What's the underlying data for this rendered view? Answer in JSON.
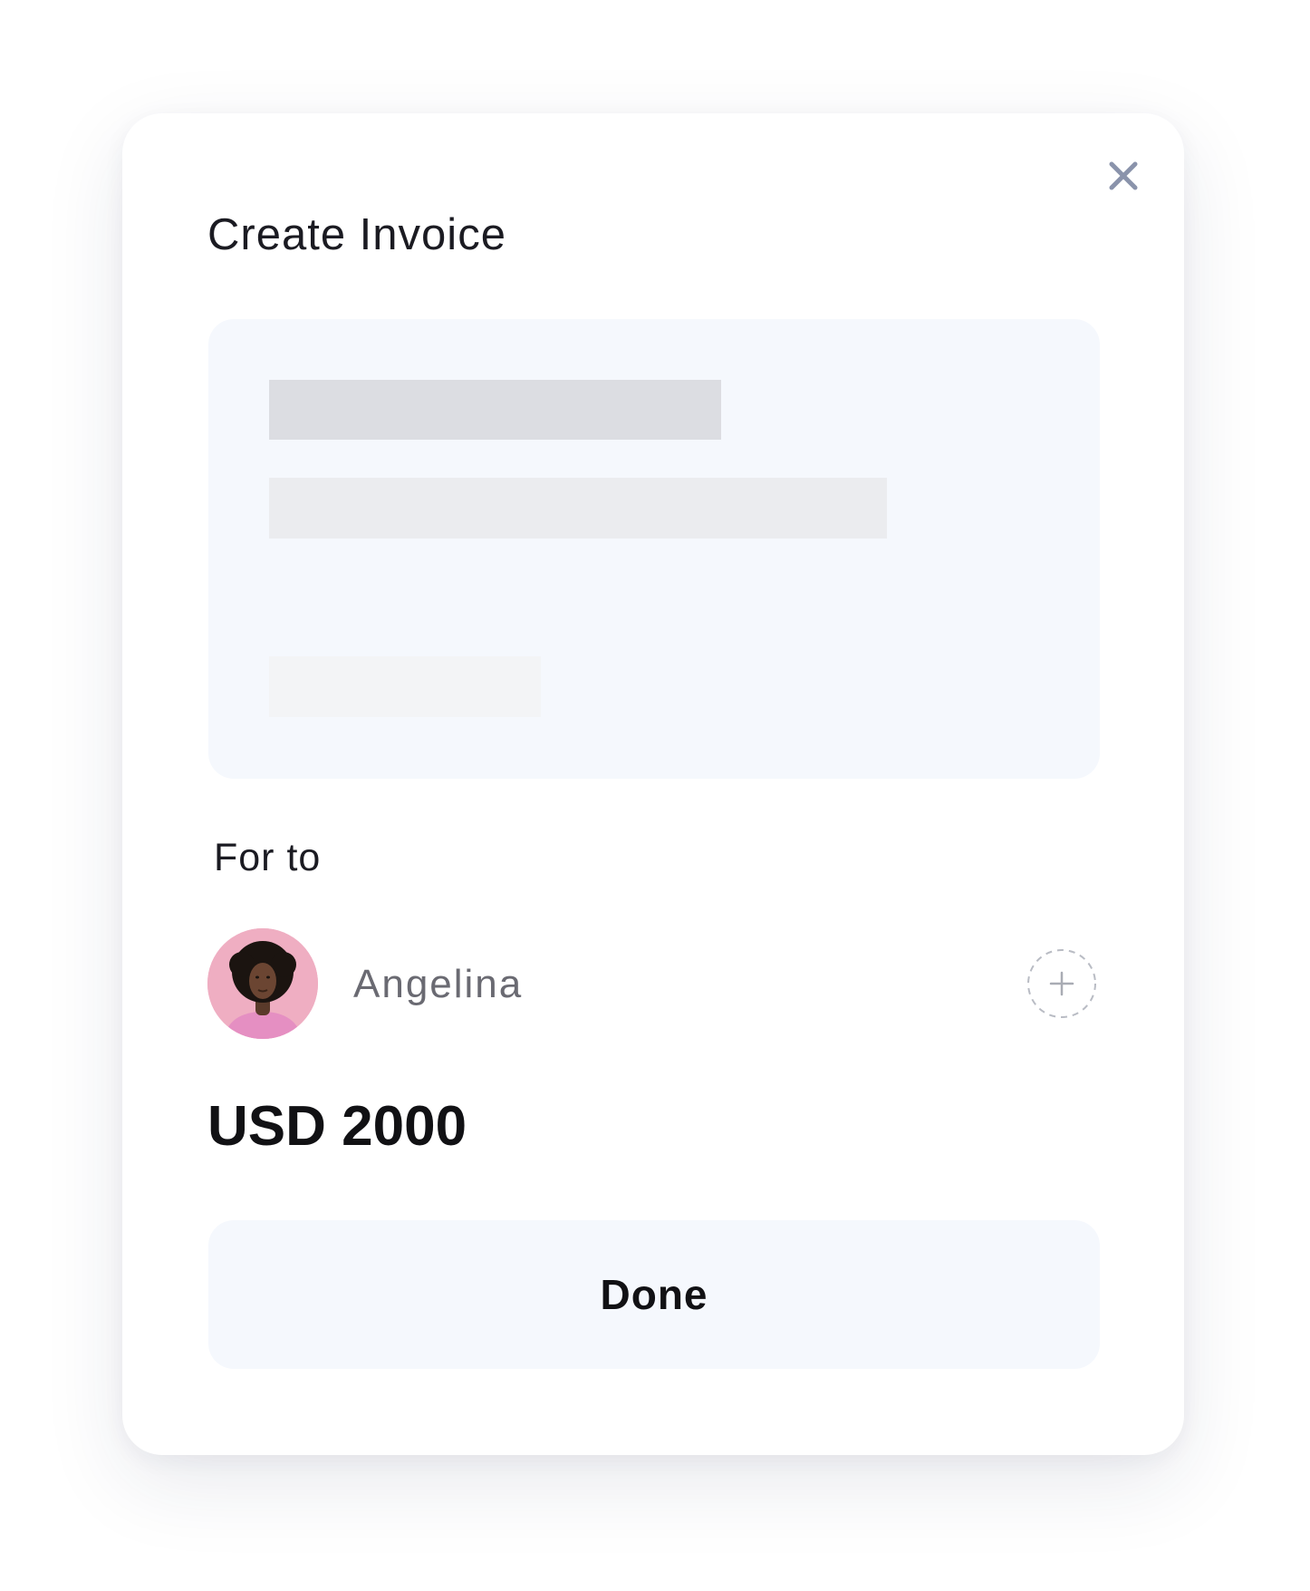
{
  "modal": {
    "title": "Create Invoice",
    "close_icon": "close-icon"
  },
  "recipient_section": {
    "label": "For to",
    "recipient": {
      "name": "Angelina",
      "avatar_icon": "avatar"
    },
    "add_icon": "plus-circle-icon"
  },
  "amount": {
    "text": "USD 2000"
  },
  "actions": {
    "done_label": "Done"
  },
  "colors": {
    "card_background": "#ffffff",
    "preview_background": "#f5f8fd",
    "button_background": "#f5f8fd",
    "close_icon": "#8a93ab",
    "text_primary": "#111114",
    "text_secondary": "#6a6a72",
    "avatar_background": "#efaec2"
  }
}
